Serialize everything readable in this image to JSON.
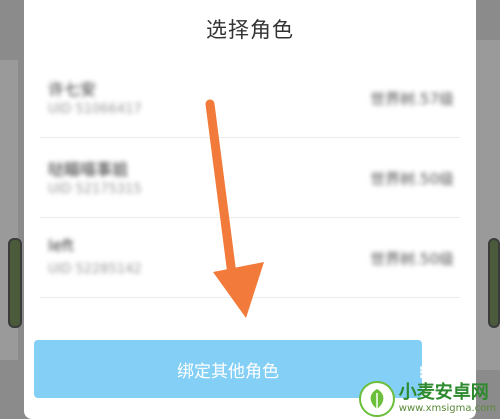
{
  "dialog": {
    "title": "选择角色",
    "bind_button_label": "绑定其他角色"
  },
  "roles": [
    {
      "name": "许七安",
      "uid": "UID 51066417",
      "level": "世界树.57级"
    },
    {
      "name": "哒瞄喵事姐",
      "uid": "UID 52175315",
      "level": "世界树.50级"
    },
    {
      "name": "left",
      "uid": "UID 52285142",
      "level": "世界树.50级"
    }
  ],
  "watermark": {
    "title": "小麦安卓网",
    "url": "www.xmsigma.com"
  },
  "colors": {
    "button": "#84cff6",
    "arrow": "#f27a3a",
    "overlay": "#8b8b8b"
  }
}
